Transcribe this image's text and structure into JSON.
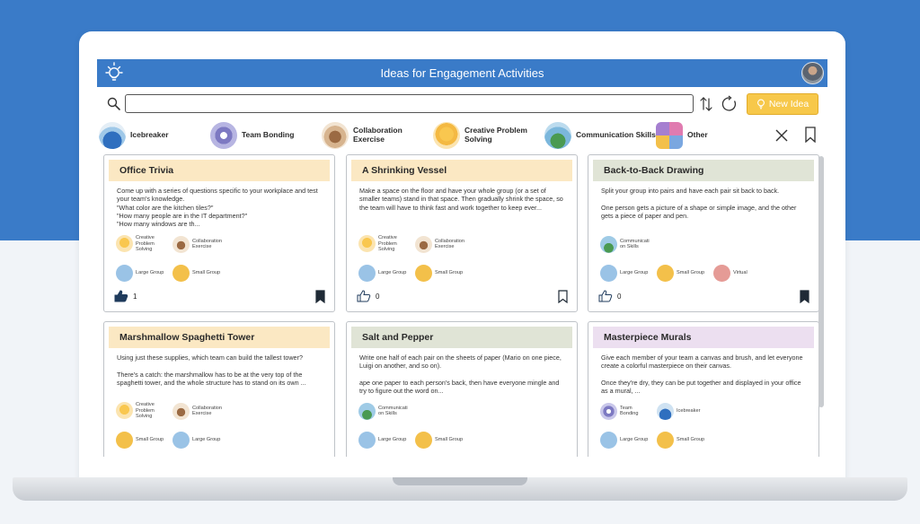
{
  "app": {
    "title": "Ideas for Engagement Activities"
  },
  "toolbar": {
    "search_placeholder": "",
    "new_idea_label": "New Idea"
  },
  "categories": [
    {
      "label": "Icebreaker",
      "icon": "icebreaker-icon"
    },
    {
      "label": "Team Bonding",
      "icon": "team-bonding-icon"
    },
    {
      "label": "Collaboration\nExercise",
      "icon": "collaboration-icon"
    },
    {
      "label": "Creative Problem\nSolving",
      "icon": "creative-icon"
    },
    {
      "label": "Communication Skills",
      "icon": "communication-icon"
    },
    {
      "label": "Other",
      "icon": "other-icon"
    }
  ],
  "cards": [
    {
      "title": "Office Trivia",
      "description": "Come up with a series of questions specific to your workplace and test your team's knowledge.\n\"What color are the kitchen tiles?\"\n\"How many people are in the IT department?\"\n\"How many windows are th...",
      "categories": [
        "Creative Problem Solving",
        "Collaboration Exercise"
      ],
      "sizes": [
        "Large Group",
        "Small Group"
      ],
      "likes": "1",
      "liked": true,
      "bookmarked": true,
      "header_color": "#fbe8c3"
    },
    {
      "title": "A Shrinking Vessel",
      "description": "Make a space on the floor and have your whole group (or a set of smaller teams) stand in that space. Then gradually shrink the space, so the team will have to think fast and work together to keep ever...",
      "categories": [
        "Creative Problem Solving",
        "Collaboration Exercise"
      ],
      "sizes": [
        "Large Group",
        "Small Group"
      ],
      "likes": "0",
      "liked": false,
      "bookmarked": false,
      "header_color": "#fbe8c3"
    },
    {
      "title": "Back-to-Back Drawing",
      "description": "Split your group into pairs and have each pair sit back to back.\n\nOne person gets a picture of a shape or simple image, and the other gets a piece of paper and pen.",
      "categories": [
        "Communication Skills"
      ],
      "sizes": [
        "Large Group",
        "Small Group",
        "Virtual"
      ],
      "likes": "0",
      "liked": false,
      "bookmarked": true,
      "header_color": "#e0e4d6"
    },
    {
      "title": "Marshmallow Spaghetti Tower",
      "description": "Using just these supplies, which team can build the tallest tower?\n\nThere's a catch: the marshmallow has to be at the very top of the spaghetti tower, and the whole structure has to stand on its own ...",
      "categories": [
        "Creative Problem Solving",
        "Collaboration Exercise"
      ],
      "sizes": [
        "Small Group",
        "Large Group"
      ],
      "likes": "",
      "liked": false,
      "bookmarked": false,
      "header_color": "#fbe8c3"
    },
    {
      "title": "Salt and Pepper",
      "description": "Write one half of each pair on the sheets of paper (Mario on one piece, Luigi on another, and so on).\n\nape one paper to each person's back, then have everyone mingle and try to figure out the word on...",
      "categories": [
        "Communication Skills"
      ],
      "sizes": [
        "Large Group",
        "Small Group"
      ],
      "likes": "",
      "liked": false,
      "bookmarked": false,
      "header_color": "#e0e4d6"
    },
    {
      "title": "Masterpiece Murals",
      "description": "Give each member of your team a canvas and brush, and let everyone create a colorful masterpiece on their canvas.\n\nOnce they're dry, they can be put together and displayed in your office as a mural, ...",
      "categories": [
        "Team Bonding",
        "Icebreaker"
      ],
      "sizes": [
        "Large Group",
        "Small Group"
      ],
      "likes": "",
      "liked": false,
      "bookmarked": false,
      "header_color": "#ecdff0"
    }
  ],
  "tag_labels": {
    "creative": "Creative\nProblem\nSolving",
    "collab": "Collaboration\nExercise",
    "comm": "Communicati\non Skills",
    "team": "Team\nBonding",
    "ice": "Icebreaker",
    "large": "Large Group",
    "small": "Small Group",
    "virtual": "Virtual"
  },
  "colors": {
    "brand_blue": "#3a7bc8",
    "accent_yellow": "#f7c84a"
  }
}
